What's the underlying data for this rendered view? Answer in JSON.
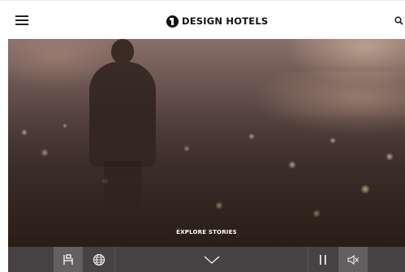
{
  "header": {
    "brand": "DESIGN HOTELS"
  },
  "hero": {
    "cta_label": "EXPLORE STORIES"
  },
  "controls": {
    "left": [
      "bed-icon",
      "globe-icon"
    ],
    "center": "chevron-down-icon",
    "right": [
      "pause-icon",
      "mute-icon"
    ]
  },
  "colors": {
    "header_bg": "#ffffff",
    "brand_text": "#111111",
    "control_bar": "#373234"
  }
}
